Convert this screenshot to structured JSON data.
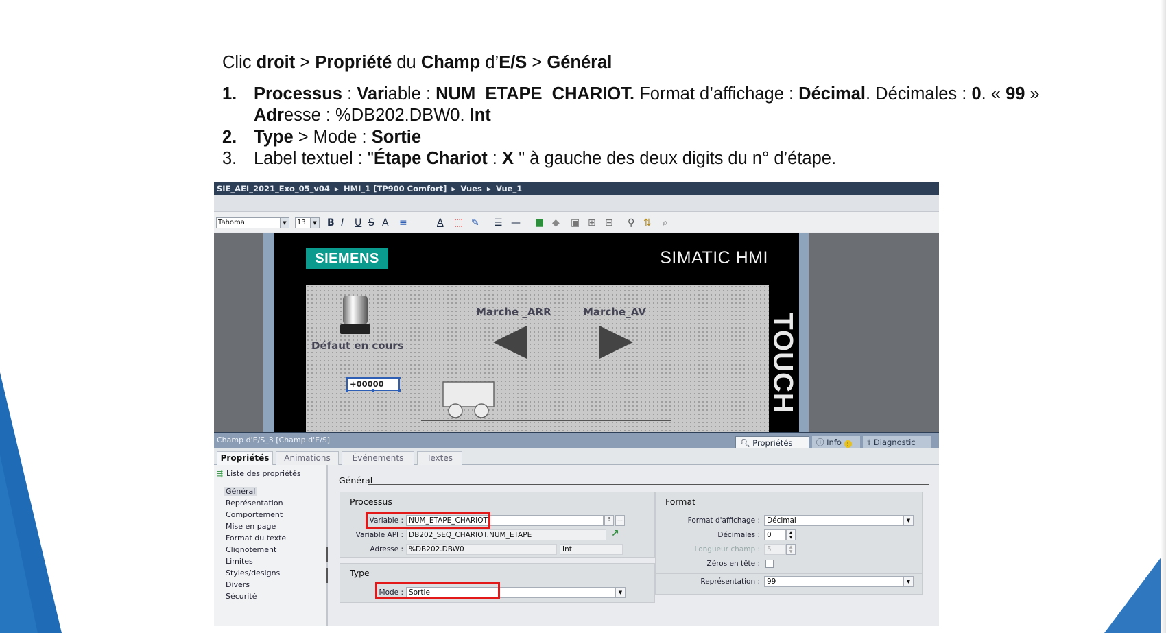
{
  "instructions": {
    "head": {
      "p1": "Clic ",
      "b1": "droit",
      "p2": " > ",
      "b2": "Propriété",
      "p3": " du ",
      "b3": "Champ",
      "p4": " d’",
      "b4": "E/S",
      "p5": " > ",
      "b5": "Général"
    },
    "step1": {
      "num": "1.",
      "b1": "Processus",
      "p1": " : ",
      "b2": "Var",
      "p2": "iable : ",
      "b3": "NUM_ETAPE_CHARIOT.",
      "p3": " Format d’affichage : ",
      "b4": "Décimal",
      "p4": ". Décimales : ",
      "b5": "0",
      "p5": ". « ",
      "b6": "99",
      "p6": " »"
    },
    "step1b": {
      "b1": "Adr",
      "p1": "esse : %DB202.DBW0. ",
      "b2": "Int"
    },
    "step2": {
      "num": "2.",
      "b1": "Type",
      "p1": " > Mode : ",
      "b2": "Sortie"
    },
    "step3": {
      "num": "3.",
      "p1": "Label textuel : \"",
      "b1": "Étape Chariot",
      "p2": " : ",
      "b2": "X",
      "p3": " \" à gauche des deux digits du n° d’étape."
    }
  },
  "breadcrumb": [
    "SIE_AEI_2021_Exo_05_v04",
    "HMI_1 [TP900 Comfort]",
    "Vues",
    "Vue_1"
  ],
  "toolbar": {
    "font": "Tahoma",
    "size": "13",
    "buttons": [
      "B",
      "I",
      "U",
      "S",
      "A",
      "≡",
      "A",
      "⬚",
      "✎",
      "☰",
      "—",
      "■",
      "◆",
      "▣",
      "⊞",
      "⊟",
      "⚲",
      "⇅",
      "⌕"
    ]
  },
  "hmi": {
    "brand": "SIEMENS",
    "product": "SIMATIC HMI",
    "touch": "TOUCH",
    "label_defaut": "Défaut en cours",
    "label_arr": "Marche _ARR",
    "label_av": "Marche_AV",
    "io_value": "+00000"
  },
  "inspector": {
    "title": "Champ d'E/S_3 [Champ d'E/S]",
    "tabs": [
      "Propriétés",
      "Info",
      "Diagnostic"
    ],
    "subtabs": [
      "Propriétés",
      "Animations",
      "Événements",
      "Textes"
    ],
    "nav_head": "Liste des propriétés",
    "nav_items": [
      "Général",
      "Représentation",
      "Comportement",
      "Mise en page",
      "Format du texte",
      "Clignotement",
      "Limites",
      "Styles/designs",
      "Divers",
      "Sécurité"
    ],
    "general_title": "Général",
    "processus": {
      "title": "Processus",
      "variable_label": "Variable :",
      "variable_value": "NUM_ETAPE_CHARIOT",
      "api_label": "Variable API :",
      "api_value": "DB202_SEQ_CHARIOT.NUM_ETAPE",
      "address_label": "Adresse :",
      "address_value": "%DB202.DBW0",
      "address_type": "Int",
      "browse": "..."
    },
    "type": {
      "title": "Type",
      "mode_label": "Mode :",
      "mode_value": "Sortie"
    },
    "format": {
      "title": "Format",
      "display_label": "Format d'affichage :",
      "display_value": "Décimal",
      "decimals_label": "Décimales :",
      "decimals_value": "0",
      "length_label": "Longueur champ :",
      "length_value": "5",
      "zeros_label": "Zéros en tête :",
      "repr_label": "Représentation :",
      "repr_value": "99"
    }
  },
  "colors": {
    "crumb_bg": "#2d3f57",
    "siemens": "#0a9a8e",
    "highlight": "#e31919",
    "slide_blue": "#1f6bb5"
  }
}
